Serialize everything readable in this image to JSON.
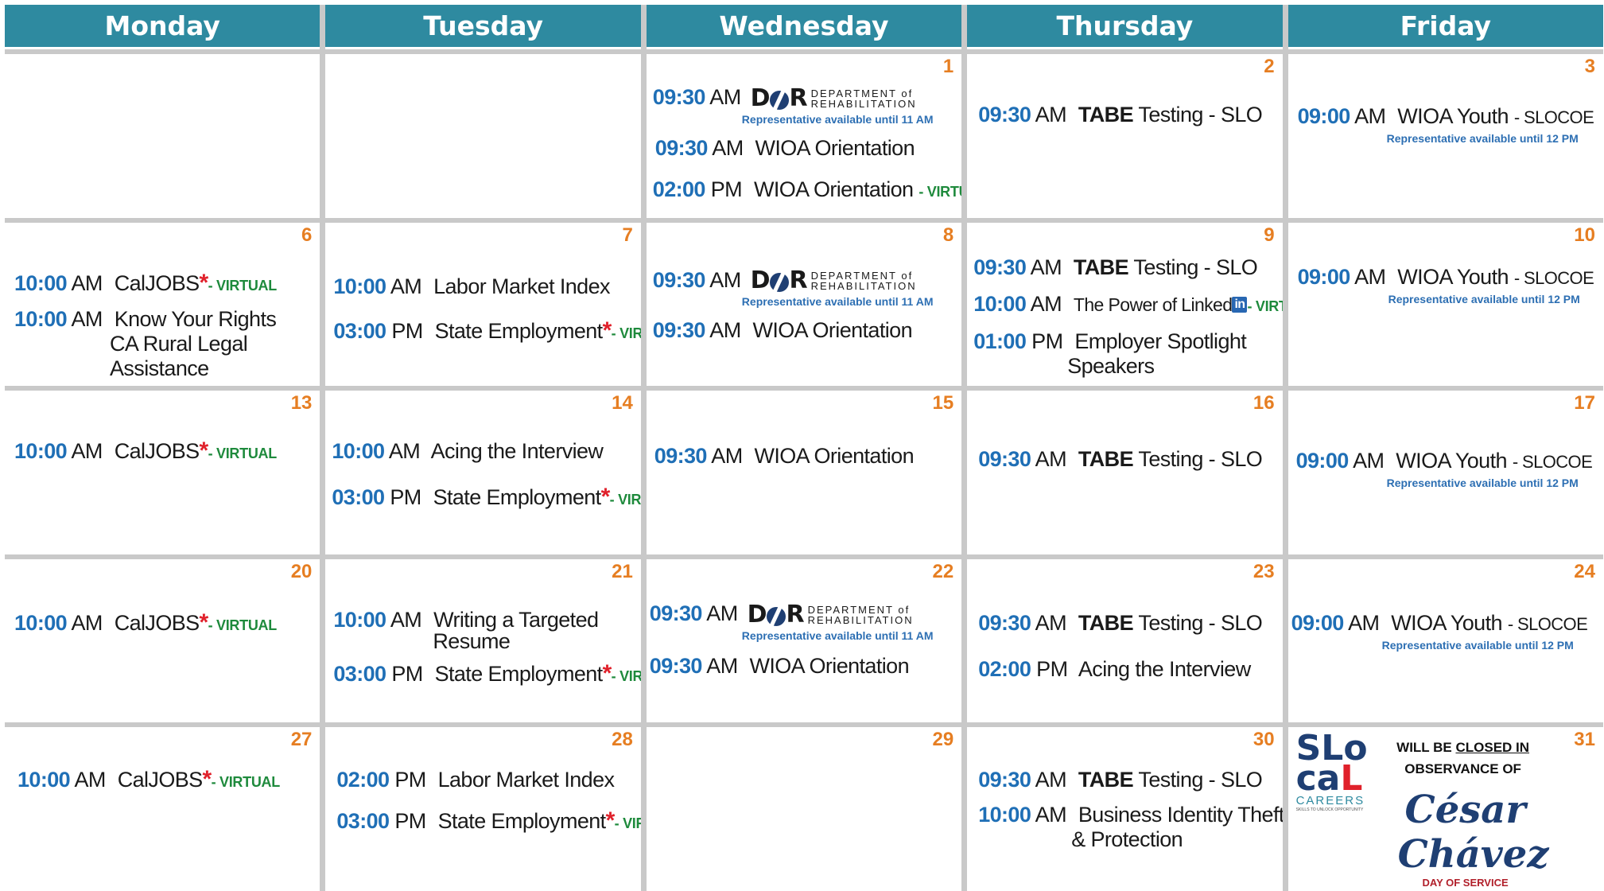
{
  "days": [
    "Monday",
    "Tuesday",
    "Wednesday",
    "Thursday",
    "Friday"
  ],
  "labels": {
    "am": "AM",
    "pm": "PM",
    "virtual": "- VIRTUAL",
    "asterisk": "*",
    "dor_mark_d": "D",
    "dor_mark_r": "R",
    "dor_text_1": "DEPARTMENT of",
    "dor_text_2": "REHABILITATION",
    "li_in": "in"
  },
  "week1": {
    "wed": {
      "num": "1",
      "e1_time": "09:30",
      "e1_note": "Representative available until 11 AM",
      "e2_time": "09:30",
      "e2_title": "WIOA Orientation",
      "e3_time": "02:00",
      "e3_title": "WIOA Orientation"
    },
    "thu": {
      "num": "2",
      "e1_time": "09:30",
      "e1_bold": "TABE",
      "e1_rest": "Testing - SLO"
    },
    "fri": {
      "num": "3",
      "e1_time": "09:00",
      "e1_title": "WIOA Youth",
      "e1_small": "- SLOCOE",
      "e1_note": "Representative available until 12 PM"
    }
  },
  "week2": {
    "mon": {
      "num": "6",
      "e1_time": "10:00",
      "e1_title": "CalJOBS",
      "e2_time": "10:00",
      "e2_title": "Know Your Rights",
      "e2_sub1": "CA Rural Legal",
      "e2_sub2": "Assistance"
    },
    "tue": {
      "num": "7",
      "e1_time": "10:00",
      "e1_title": "Labor Market Index",
      "e2_time": "03:00",
      "e2_title": "State Employment"
    },
    "wed": {
      "num": "8",
      "e1_time": "09:30",
      "e1_note": "Representative available until 11 AM",
      "e2_time": "09:30",
      "e2_title": "WIOA Orientation"
    },
    "thu": {
      "num": "9",
      "e1_time": "09:30",
      "e1_bold": "TABE",
      "e1_rest": "Testing - SLO",
      "e2_time": "10:00",
      "e2_title": "The Power of Linked",
      "e3_time": "01:00",
      "e3_title": "Employer Spotlight",
      "e3_sub": "Speakers"
    },
    "fri": {
      "num": "10",
      "e1_time": "09:00",
      "e1_title": "WIOA Youth",
      "e1_small": "- SLOCOE",
      "e1_note": "Representative available until 12 PM"
    }
  },
  "week3": {
    "mon": {
      "num": "13",
      "e1_time": "10:00",
      "e1_title": "CalJOBS"
    },
    "tue": {
      "num": "14",
      "e1_time": "10:00",
      "e1_title": "Acing the Interview",
      "e2_time": "03:00",
      "e2_title": "State Employment"
    },
    "wed": {
      "num": "15",
      "e1_time": "09:30",
      "e1_title": "WIOA Orientation"
    },
    "thu": {
      "num": "16",
      "e1_time": "09:30",
      "e1_bold": "TABE",
      "e1_rest": "Testing - SLO"
    },
    "fri": {
      "num": "17",
      "e1_time": "09:00",
      "e1_title": "WIOA Youth",
      "e1_small": "- SLOCOE",
      "e1_note": "Representative available until 12 PM"
    }
  },
  "week4": {
    "mon": {
      "num": "20",
      "e1_time": "10:00",
      "e1_title": "CalJOBS"
    },
    "tue": {
      "num": "21",
      "e1_time": "10:00",
      "e1_title": "Writing a Targeted",
      "e1_sub": "Resume",
      "e2_time": "03:00",
      "e2_title": "State Employment"
    },
    "wed": {
      "num": "22",
      "e1_time": "09:30",
      "e1_note": "Representative available until 11 AM",
      "e2_time": "09:30",
      "e2_title": "WIOA Orientation"
    },
    "thu": {
      "num": "23",
      "e1_time": "09:30",
      "e1_bold": "TABE",
      "e1_rest": "Testing - SLO",
      "e2_time": "02:00",
      "e2_title": "Acing the Interview"
    },
    "fri": {
      "num": "24",
      "e1_time": "09:00",
      "e1_title": "WIOA Youth",
      "e1_small": "- SLOCOE",
      "e1_note": "Representative available until 12 PM"
    }
  },
  "week5": {
    "mon": {
      "num": "27",
      "e1_time": "10:00",
      "e1_title": "CalJOBS"
    },
    "tue": {
      "num": "28",
      "e1_time": "02:00",
      "e1_title": "Labor Market Index",
      "e2_time": "03:00",
      "e2_title": "State Employment"
    },
    "wed": {
      "num": "29"
    },
    "thu": {
      "num": "30",
      "e1_time": "09:30",
      "e1_bold": "TABE",
      "e1_rest": "Testing - SLO",
      "e2_time": "10:00",
      "e2_title": "Business Identity Theft",
      "e2_sub": "& Protection"
    },
    "fri": {
      "num": "31",
      "closed_1": "WILL BE",
      "closed_2": "CLOSED IN",
      "closed_3": "OBSERVANCE OF",
      "logo_line1": "SLo",
      "logo_line2a": "ca",
      "logo_line2b": "L",
      "logo_careers": "CAREERS",
      "logo_tagline": "SKILLS TO UNLOCK OPPORTUNITY",
      "chavez_1": "César",
      "chavez_2": "Chávez",
      "chavez_3": "DAY OF SERVICE"
    }
  }
}
